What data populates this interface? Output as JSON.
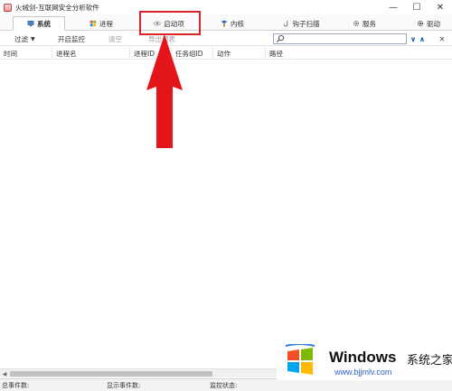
{
  "window": {
    "title": "火绒剑-互联网安全分析软件",
    "controls": {
      "minimize": "—",
      "maximize": "☐",
      "close": "✕"
    }
  },
  "tabs": [
    {
      "label": "系统",
      "icon": "monitor-icon",
      "active": true
    },
    {
      "label": "进程",
      "icon": "windows-logo-icon",
      "active": false
    },
    {
      "label": "启动项",
      "icon": "eye-icon",
      "active": false
    },
    {
      "label": "内核",
      "icon": "hammer-icon",
      "active": false
    },
    {
      "label": "钩子扫描",
      "icon": "hook-icon",
      "active": false
    },
    {
      "label": "服务",
      "icon": "gear-icon",
      "active": false
    },
    {
      "label": "驱动",
      "icon": "gear-icon",
      "active": false
    }
  ],
  "toolbar": {
    "filter_label": "过滤",
    "start_monitor_label": "开启监控",
    "clear_label": "清空",
    "export_label": "导出报表",
    "search": {
      "value": "",
      "placeholder": ""
    },
    "nav_down": "∨",
    "nav_up": "∧",
    "close_search": "✕"
  },
  "columns": [
    "时间",
    "进程名",
    "进程ID",
    "任务组ID",
    "动作",
    "路径"
  ],
  "rows": [],
  "statusbar": {
    "total_events": "总事件数:",
    "shown_events": "显示事件数:",
    "monitor_status": "监控状态:"
  },
  "watermark": {
    "brand": "Windows",
    "brand_cn": "系统之家",
    "url": "www.bjjmlv.com"
  },
  "colors": {
    "highlight": "#d9252a",
    "arrow": "#e3151a",
    "accent": "#1c5fb8"
  }
}
